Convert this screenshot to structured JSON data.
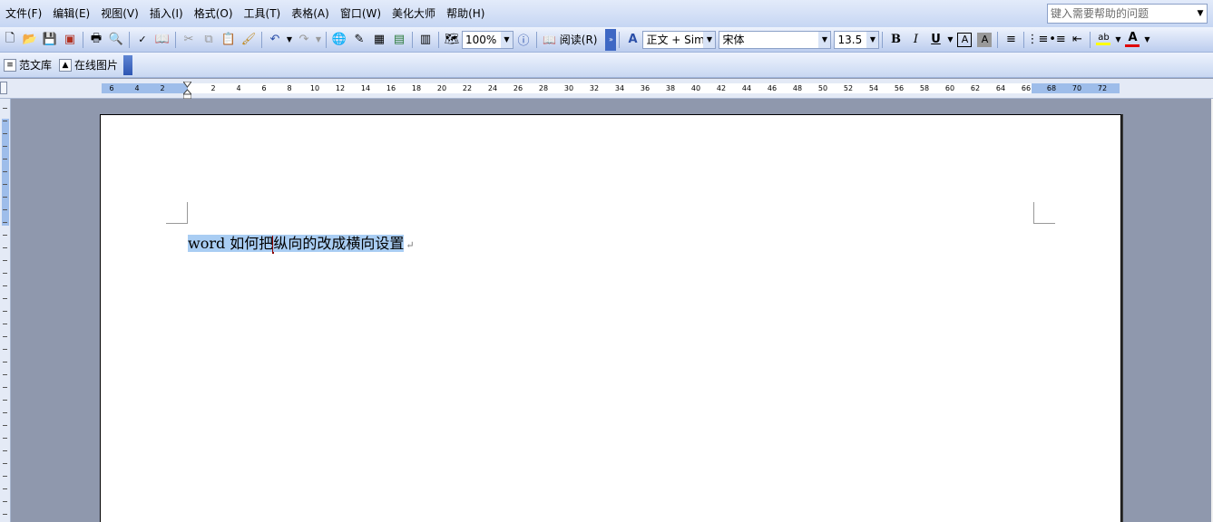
{
  "menubar": {
    "items": [
      "文件(F)",
      "编辑(E)",
      "视图(V)",
      "插入(I)",
      "格式(O)",
      "工具(T)",
      "表格(A)",
      "窗口(W)",
      "美化大师",
      "帮助(H)"
    ],
    "help_placeholder": "键入需要帮助的问题"
  },
  "toolbar": {
    "zoom": "100%",
    "read_label": "阅读(R)",
    "style": "正文 + Sim",
    "font": "宋体",
    "size": "13.5",
    "bold": "B",
    "italic": "I",
    "underline": "U",
    "char_border": "A",
    "char_shading": "A",
    "font_color": "A",
    "highlight": "ab"
  },
  "toolbar2": {
    "items": [
      "范文库",
      "在线图片"
    ]
  },
  "ruler": {
    "ticks": [
      "6",
      "4",
      "2",
      "2",
      "4",
      "6",
      "8",
      "10",
      "12",
      "14",
      "16",
      "18",
      "20",
      "22",
      "24",
      "26",
      "28",
      "30",
      "32",
      "34",
      "36",
      "38",
      "40",
      "42",
      "44",
      "46",
      "48",
      "50",
      "52",
      "54",
      "56",
      "58",
      "60",
      "62",
      "64",
      "66",
      "68",
      "70",
      "72"
    ]
  },
  "document": {
    "text_before_cursor": "word 如何把",
    "text_after_cursor": "纵向的改成横向设置",
    "para_mark": "↵"
  },
  "colors": {
    "selection": "#a9cdf3",
    "font_color_bar": "#e00000",
    "highlight_bar": "#ffff00"
  }
}
